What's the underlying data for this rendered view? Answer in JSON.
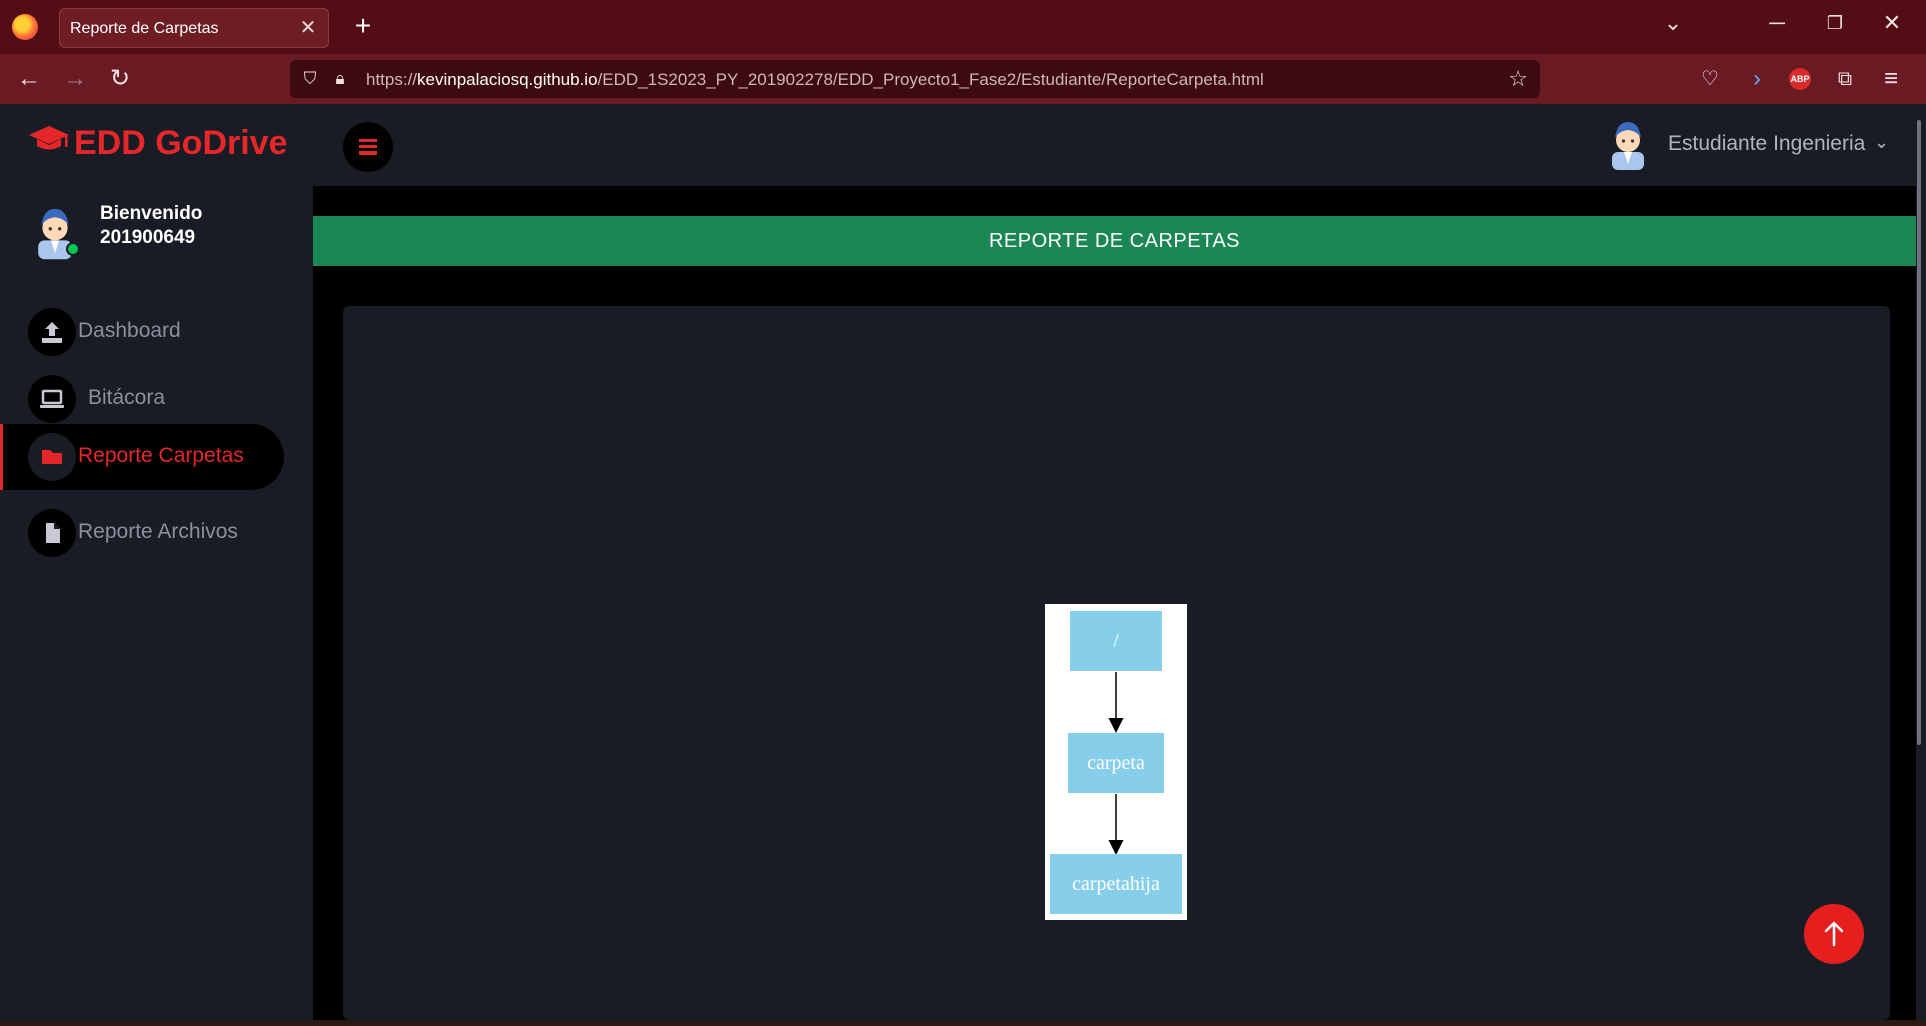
{
  "browser": {
    "tab_title": "Reporte de Carpetas",
    "tab_close": "✕",
    "new_tab": "+",
    "url_prefix": "https://",
    "url_host": "kevinpalaciosq.github.io",
    "url_path": "/EDD_1S2023_PY_201902278/EDD_Proyecto1_Fase2/Estudiante/ReporteCarpeta.html",
    "extension_abp": "ABP"
  },
  "header": {
    "brand": "EDD GoDrive",
    "user_name": "Estudiante Ingenieria"
  },
  "sidebar": {
    "welcome": "Bienvenido",
    "user_id": "201900649",
    "items": [
      {
        "label": "Dashboard",
        "icon": "upload-icon",
        "active": false
      },
      {
        "label": "Bitácora",
        "icon": "laptop-icon",
        "active": false
      },
      {
        "label": "Reporte Carpetas",
        "icon": "folder-icon",
        "active": true
      },
      {
        "label": "Reporte Archivos",
        "icon": "file-icon",
        "active": false
      }
    ]
  },
  "main": {
    "banner_title": "REPORTE DE CARPETAS",
    "graph": {
      "nodes": [
        "/",
        "carpeta",
        "carpetahija"
      ],
      "edges": [
        [
          "/",
          "carpeta"
        ],
        [
          "carpeta",
          "carpetahija"
        ]
      ],
      "node_color": "#87ceeb"
    }
  },
  "colors": {
    "accent": "#e6272a",
    "banner": "#1b8754",
    "panel": "#191c24",
    "browser_frame": "#530d14"
  }
}
